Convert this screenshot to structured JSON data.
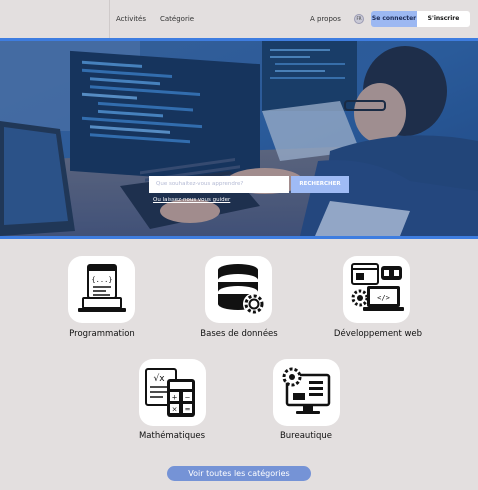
{
  "header": {
    "nav": [
      {
        "label": "Activités"
      },
      {
        "label": "Catégorie"
      },
      {
        "label": "A propos"
      }
    ],
    "lang": "FR",
    "login_label": "Se connecter",
    "signup_label": "S'inscrire"
  },
  "hero": {
    "search_placeholder": "Que souhaitez-vous apprendre?",
    "search_button": "RECHERCHER",
    "guide_link": "Ou laissez-nous vous guider"
  },
  "categories": [
    {
      "label": "Programmation",
      "icon": "programming-icon"
    },
    {
      "label": "Bases de données",
      "icon": "database-icon"
    },
    {
      "label": "Développement web",
      "icon": "web-development-icon"
    },
    {
      "label": "Mathématiques",
      "icon": "math-icon"
    },
    {
      "label": "Bureautique",
      "icon": "office-icon"
    }
  ],
  "all_categories_label": "Voir toutes les catégories",
  "colors": {
    "accent": "#3e7de0",
    "button": "#7593d6",
    "background": "#e3dfdf"
  }
}
